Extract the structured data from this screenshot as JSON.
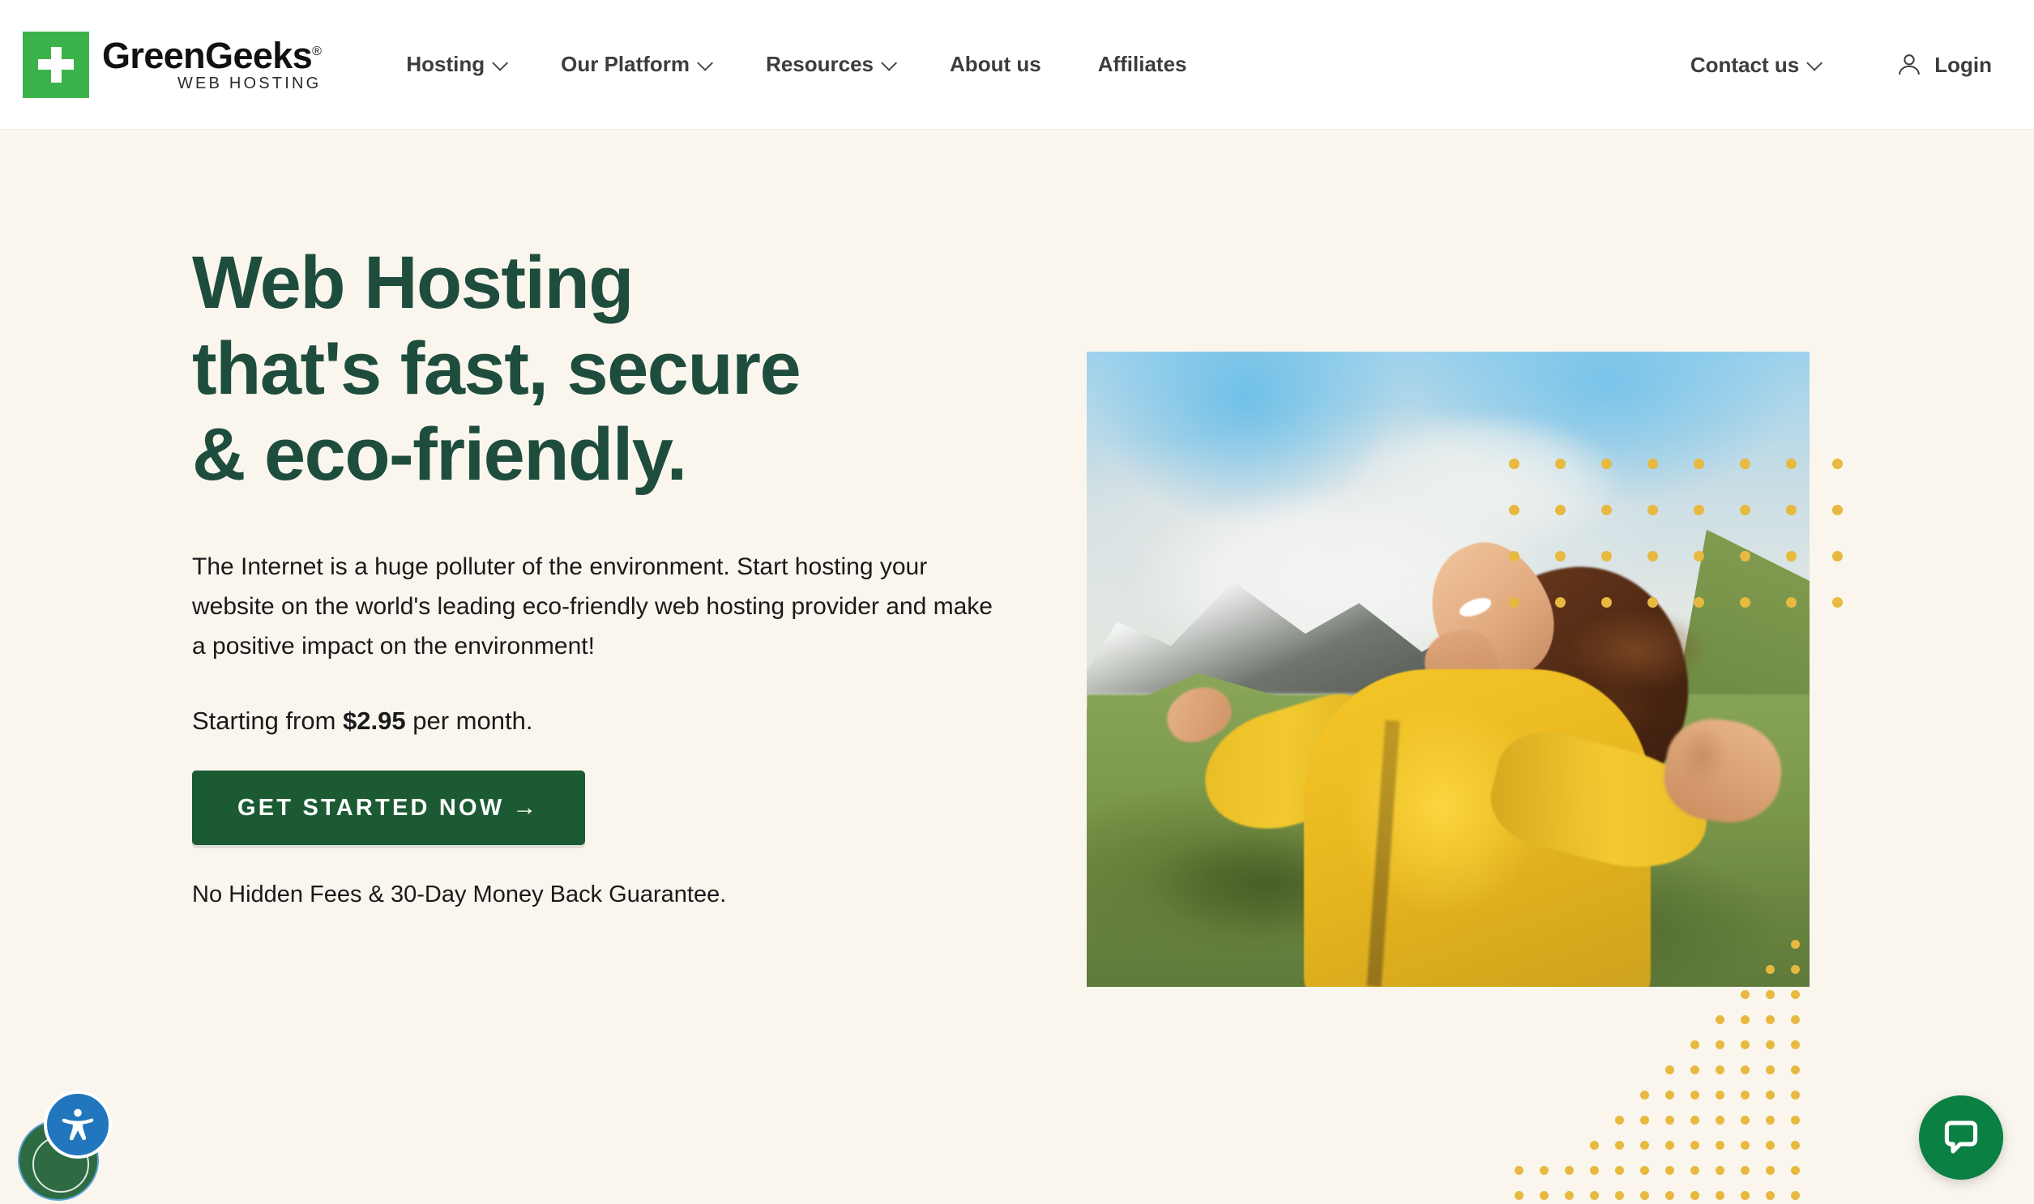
{
  "theme": {
    "brand_green": "#3cb34a",
    "dark_green": "#1e4d3d",
    "cta_green": "#1b5a32",
    "cream_bg": "#faf6ee",
    "dot_gold": "#e8b93f",
    "nav_text": "#3d3d3d",
    "chat_green": "#0a8043",
    "a11y_blue": "#2176bd"
  },
  "header": {
    "logo": {
      "word": "GreenGeeks",
      "registered": "®",
      "tagline": "WEB HOSTING",
      "mark_icon": "plus-icon"
    },
    "nav": [
      {
        "label": "Hosting",
        "has_dropdown": true
      },
      {
        "label": "Our Platform",
        "has_dropdown": true
      },
      {
        "label": "Resources",
        "has_dropdown": true
      },
      {
        "label": "About us",
        "has_dropdown": false
      },
      {
        "label": "Affiliates",
        "has_dropdown": false
      }
    ],
    "contact": {
      "label": "Contact us",
      "has_dropdown": true
    },
    "login": {
      "label": "Login",
      "icon": "user-icon"
    }
  },
  "hero": {
    "title_lines": [
      "Web Hosting",
      "that's fast, secure",
      "& eco-friendly."
    ],
    "paragraph": "The Internet is a huge polluter of the environment. Start hosting your website on the world's leading eco-friendly web hosting provider and make a positive impact on the environment!",
    "price_prefix": "Starting from ",
    "price_amount": "$2.95",
    "price_suffix": " per month.",
    "cta_label": "GET STARTED NOW",
    "cta_arrow": "→",
    "note": "No Hidden Fees & 30-Day Money Back Guarantee.",
    "image_alt": "Smiling woman in a yellow jacket with arms outstretched on a green mountain hillside"
  },
  "widgets": {
    "accessibility": {
      "name": "accessibility-widget",
      "icon": "accessibility-person-icon"
    },
    "chat": {
      "name": "live-chat-button",
      "icon": "chat-bubble-icon"
    }
  },
  "decor": {
    "dots_top_right": {
      "cols": 8,
      "rows": 4,
      "spacing": 57,
      "size": 13
    },
    "dots_bottom_right": {
      "cols": 9,
      "rows": 9,
      "spacing": 31,
      "size": 11,
      "shape": "staircase-triangle"
    }
  }
}
